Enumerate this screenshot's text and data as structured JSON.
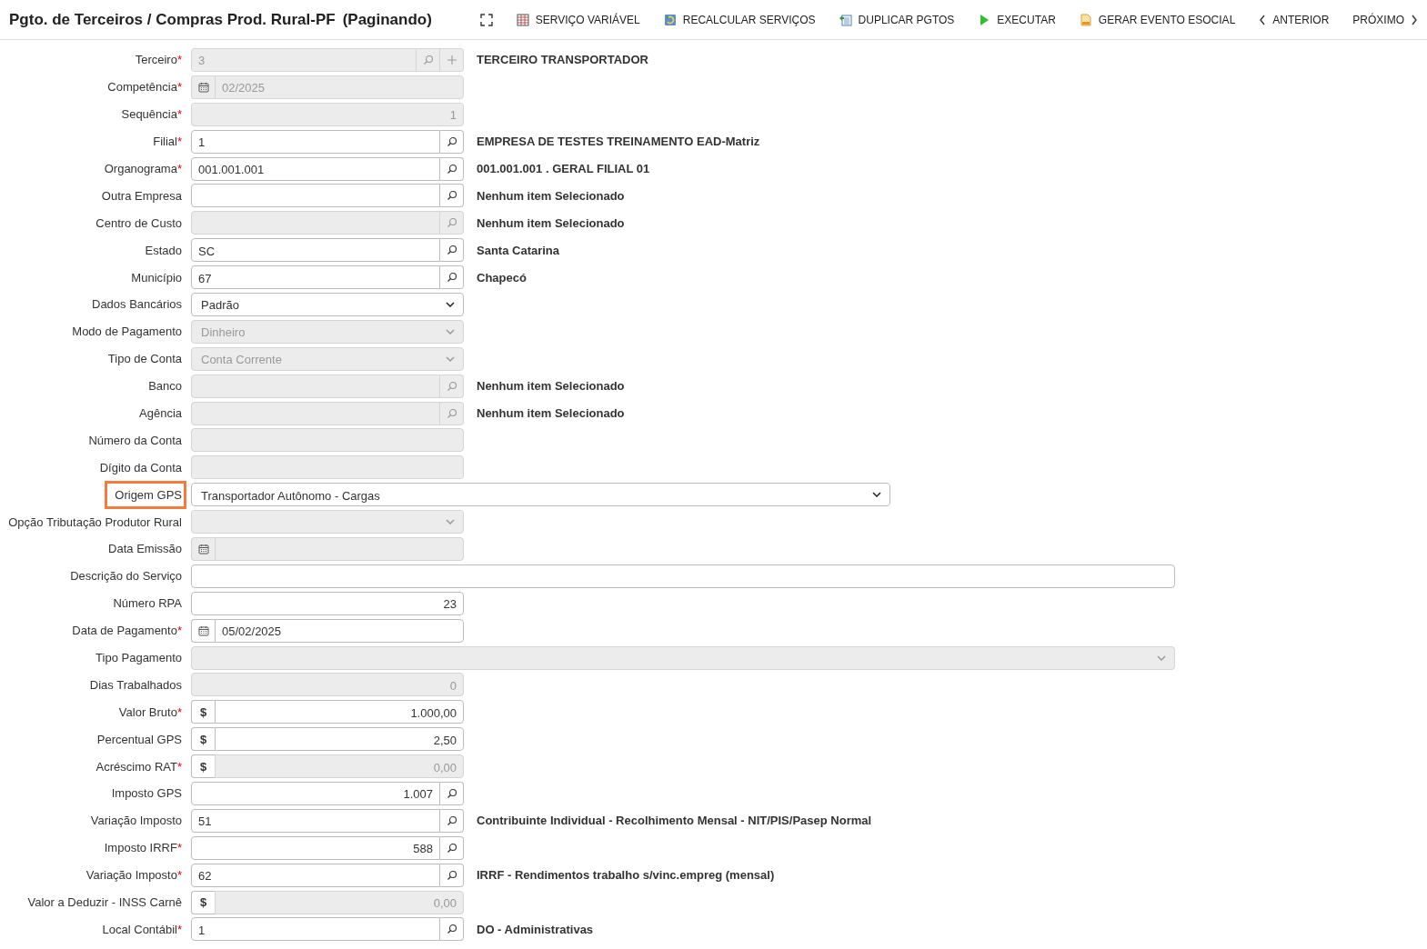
{
  "header": {
    "title": "Pgto. de Terceiros / Compras Prod. Rural-PF",
    "status": "(Paginando)"
  },
  "toolbar": [
    {
      "kind": "fullscreen"
    },
    {
      "kind": "grid",
      "label": "SERVIÇO VARIÁVEL"
    },
    {
      "kind": "recalc",
      "label": "RECALCULAR SERVIÇOS"
    },
    {
      "kind": "duplicate",
      "label": "DUPLICAR PGTOS"
    },
    {
      "kind": "play",
      "label": "EXECUTAR"
    },
    {
      "kind": "document",
      "label": "GERAR EVENTO ESOCIAL"
    },
    {
      "kind": "prev",
      "label": "ANTERIOR"
    },
    {
      "kind": "next",
      "label": "PRÓXIMO"
    }
  ],
  "fields": [
    {
      "label": "Terceiro",
      "mark": "*",
      "kind": "lookup",
      "value": "3",
      "disabled": true,
      "highlighted": false,
      "add_button": true,
      "description": "TERCEIRO TRANSPORTADOR"
    },
    {
      "label": "Competência",
      "mark": "*",
      "kind": "date",
      "value": "02/2025",
      "disabled": true,
      "highlighted": false
    },
    {
      "label": "Sequência",
      "mark": "*",
      "kind": "text",
      "value": "1",
      "disabled": true,
      "highlighted": false,
      "align_right": true
    },
    {
      "label": "Filial",
      "mark": "*",
      "kind": "lookup",
      "value": "1",
      "disabled": false,
      "highlighted": false,
      "description": "EMPRESA DE TESTES TREINAMENTO EAD-Matriz"
    },
    {
      "label": "Organograma",
      "mark": "*",
      "kind": "lookup",
      "value": "001.001.001",
      "disabled": false,
      "highlighted": false,
      "description": "001.001.001 . GERAL FILIAL 01"
    },
    {
      "label": "Outra Empresa",
      "kind": "lookup",
      "disabled": false,
      "highlighted": false,
      "description": "Nenhum item Selecionado"
    },
    {
      "label": "Centro de Custo",
      "kind": "lookup",
      "disabled": true,
      "highlighted": false,
      "description": "Nenhum item Selecionado"
    },
    {
      "label": "Estado",
      "kind": "lookup",
      "value": "SC",
      "disabled": false,
      "highlighted": false,
      "description": "Santa Catarina"
    },
    {
      "label": "Município",
      "kind": "lookup",
      "value": "67",
      "disabled": false,
      "highlighted": false,
      "description": "Chapecó"
    },
    {
      "label": "Dados Bancários",
      "kind": "select",
      "value": "Padrão",
      "disabled": false,
      "highlighted": false
    },
    {
      "label": "Modo de Pagamento",
      "kind": "select",
      "value": "Dinheiro",
      "disabled": true,
      "highlighted": false
    },
    {
      "label": "Tipo de Conta",
      "kind": "select",
      "value": "Conta Corrente",
      "disabled": true,
      "highlighted": false
    },
    {
      "label": "Banco",
      "kind": "lookup",
      "disabled": true,
      "highlighted": false,
      "description": "Nenhum item Selecionado"
    },
    {
      "label": "Agência",
      "kind": "lookup",
      "disabled": true,
      "highlighted": false,
      "description": "Nenhum item Selecionado"
    },
    {
      "label": "Número da Conta",
      "kind": "text",
      "disabled": true,
      "highlighted": false
    },
    {
      "label": "Dígito da Conta",
      "kind": "text",
      "disabled": true,
      "highlighted": false
    },
    {
      "label": "Origem GPS",
      "kind": "longselect",
      "value": "Transportador Autônomo - Cargas",
      "disabled": false,
      "highlighted": true
    },
    {
      "label": "Opção Tributação Produtor Rural",
      "kind": "select",
      "disabled": true,
      "highlighted": false
    },
    {
      "label": "Data Emissão",
      "kind": "date",
      "disabled": true,
      "highlighted": false
    },
    {
      "label": "Descrição do Serviço",
      "kind": "fulltext",
      "disabled": false,
      "highlighted": false
    },
    {
      "label": "Número RPA",
      "kind": "text",
      "value": "23",
      "disabled": false,
      "highlighted": false,
      "align_right": true
    },
    {
      "label": "Data de Pagamento",
      "mark": "*",
      "kind": "date",
      "value": "05/02/2025",
      "disabled": false,
      "highlighted": false
    },
    {
      "label": "Tipo Pagamento",
      "kind": "fullselect",
      "disabled": true,
      "highlighted": false
    },
    {
      "label": "Dias Trabalhados",
      "kind": "text",
      "value": "0",
      "disabled": true,
      "highlighted": false,
      "align_right": true
    },
    {
      "label": "Valor Bruto",
      "mark": "*",
      "kind": "money",
      "prefix": "$",
      "value": "1.000,00",
      "disabled": false,
      "highlighted": false,
      "align_right": true
    },
    {
      "label": "Percentual GPS",
      "kind": "money",
      "prefix": "$",
      "value": "2,50",
      "disabled": false,
      "highlighted": false,
      "align_right": true
    },
    {
      "label": "Acréscimo RAT",
      "mark": "*",
      "kind": "money",
      "prefix": "$",
      "value": "0,00",
      "disabled": true,
      "highlighted": false,
      "align_right": true
    },
    {
      "label": "Imposto GPS",
      "kind": "lookup",
      "value": "1.007",
      "disabled": false,
      "highlighted": false,
      "align_right": true
    },
    {
      "label": "Variação Imposto",
      "kind": "lookup",
      "value": "51",
      "disabled": false,
      "highlighted": false,
      "description": "Contribuinte Individual - Recolhimento Mensal - NIT/PIS/Pasep Normal"
    },
    {
      "label": "Imposto IRRF",
      "mark": "*",
      "kind": "lookup",
      "value": "588",
      "disabled": false,
      "highlighted": false,
      "align_right": true
    },
    {
      "label": "Variação Imposto",
      "mark": "*",
      "kind": "lookup",
      "value": "62",
      "disabled": false,
      "highlighted": false,
      "description": "IRRF - Rendimentos trabalho s/vinc.empreg (mensal)"
    },
    {
      "label": "Valor a Deduzir - INSS Carnê",
      "kind": "money",
      "prefix": "$",
      "value": "0,00",
      "disabled": true,
      "highlighted": false,
      "align_right": true
    },
    {
      "label": "Local Contábil",
      "mark": "*",
      "kind": "lookup",
      "value": "1",
      "disabled": false,
      "highlighted": false,
      "description": "DO - Administrativas"
    }
  ]
}
